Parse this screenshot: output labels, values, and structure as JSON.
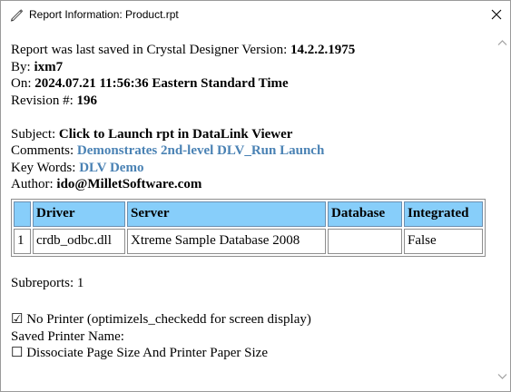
{
  "window": {
    "title": "Report Information: Product.rpt"
  },
  "report": {
    "saved_prefix": "Report was last saved in Crystal Designer Version: ",
    "version": "14.2.2.1975",
    "by_label": "By: ",
    "by_value": "ixm7",
    "on_label": "On: ",
    "on_value": "2024.07.21 11:56:36 Eastern Standard Time",
    "revision_label": "Revision #: ",
    "revision_value": "196",
    "subject_label": "Subject: ",
    "subject_value": "Click to Launch rpt in DataLink Viewer",
    "comments_label": "Comments: ",
    "comments_value": "Demonstrates 2nd-level DLV_Run Launch",
    "keywords_label": "Key Words: ",
    "keywords_value": "DLV Demo",
    "author_label": "Author: ",
    "author_value": "ido@MilletSoftware.com"
  },
  "table": {
    "headers": [
      "",
      "Driver",
      "Server",
      "Database",
      "Integrated"
    ],
    "rows": [
      [
        "1",
        "crdb_odbc.dll",
        "Xtreme Sample Database 2008",
        "",
        "False"
      ]
    ]
  },
  "subreports": "Subreports: 1",
  "no_printer": "☑ No Printer (optimizels_checkedd for screen display)",
  "saved_printer_name": "Saved Printer Name:",
  "dissociate": "☐ Dissociate Page Size And Printer Paper Size",
  "colors": {
    "header_bg": "#87cefa",
    "link_blue": "#4a82b4"
  },
  "icons": [
    "report-edit-icon",
    "close-icon",
    "scroll-up-arrow-icon",
    "scroll-down-arrow-icon"
  ]
}
